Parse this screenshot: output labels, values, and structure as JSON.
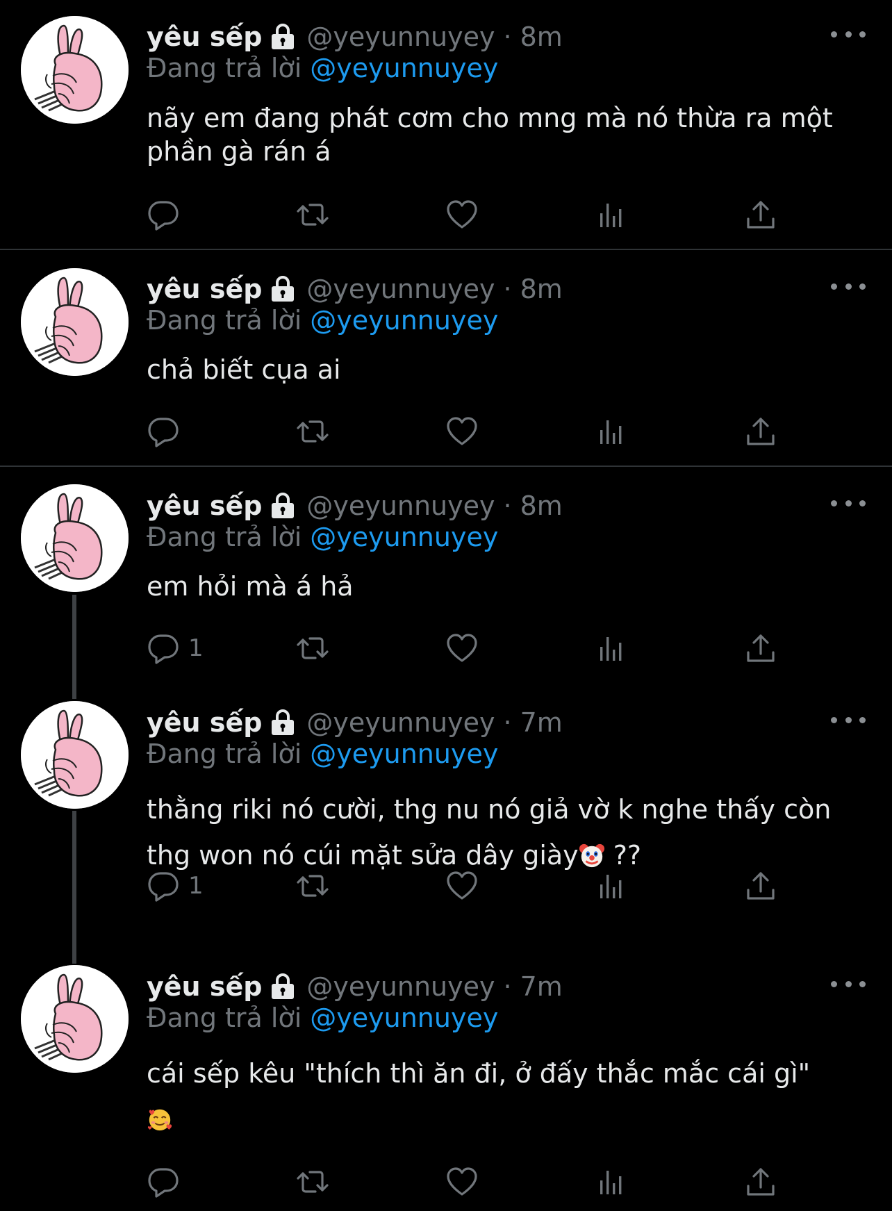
{
  "tweets": [
    {
      "name": "yêu sếp",
      "handle": "@yeyunnuyey",
      "separator": "·",
      "time": "8m",
      "replying_label": "Đang trả lời",
      "replying_to": "@yeyunnuyey",
      "text_lines": [
        "nãy em đang phát cơm cho mng mà nó thừa ra một",
        "phần gà rán á"
      ],
      "reply_count": ""
    },
    {
      "name": "yêu sếp",
      "handle": "@yeyunnuyey",
      "separator": "·",
      "time": "8m",
      "replying_label": "Đang trả lời",
      "replying_to": "@yeyunnuyey",
      "text_lines": [
        "chả biết cụa ai"
      ],
      "reply_count": ""
    },
    {
      "name": "yêu sếp",
      "handle": "@yeyunnuyey",
      "separator": "·",
      "time": "8m",
      "replying_label": "Đang trả lời",
      "replying_to": "@yeyunnuyey",
      "text_lines": [
        "em hỏi mà á hả"
      ],
      "reply_count": "1"
    },
    {
      "name": "yêu sếp",
      "handle": "@yeyunnuyey",
      "separator": "·",
      "time": "7m",
      "replying_label": "Đang trả lời",
      "replying_to": "@yeyunnuyey",
      "text_lines": [
        "thằng riki nó cười, thg nu nó giả vờ k nghe thấy còn",
        "thg won nó cúi mặt sửa dây giày",
        " ??"
      ],
      "reply_count": "1"
    },
    {
      "name": "yêu sếp",
      "handle": "@yeyunnuyey",
      "separator": "·",
      "time": "7m",
      "replying_label": "Đang trả lời",
      "replying_to": "@yeyunnuyey",
      "text_lines": [
        "cái sếp kêu \"thích thì ăn đi, ở đấy thắc mắc cái gì\""
      ],
      "reply_count": ""
    }
  ],
  "icons": {
    "lock": "lock-icon",
    "more": "more-icon",
    "reply": "reply-icon",
    "retweet": "retweet-icon",
    "like": "heart-icon",
    "views": "views-icon",
    "share": "share-icon",
    "clown": "clown-emoji-icon",
    "smiling_hearts": "smiling-face-with-hearts-icon"
  },
  "colors": {
    "background": "#000000",
    "text": "#e7e9ea",
    "muted": "#71767b",
    "mention": "#1d9bf0",
    "divider": "#2f3336",
    "thread_line": "#3e4144"
  }
}
